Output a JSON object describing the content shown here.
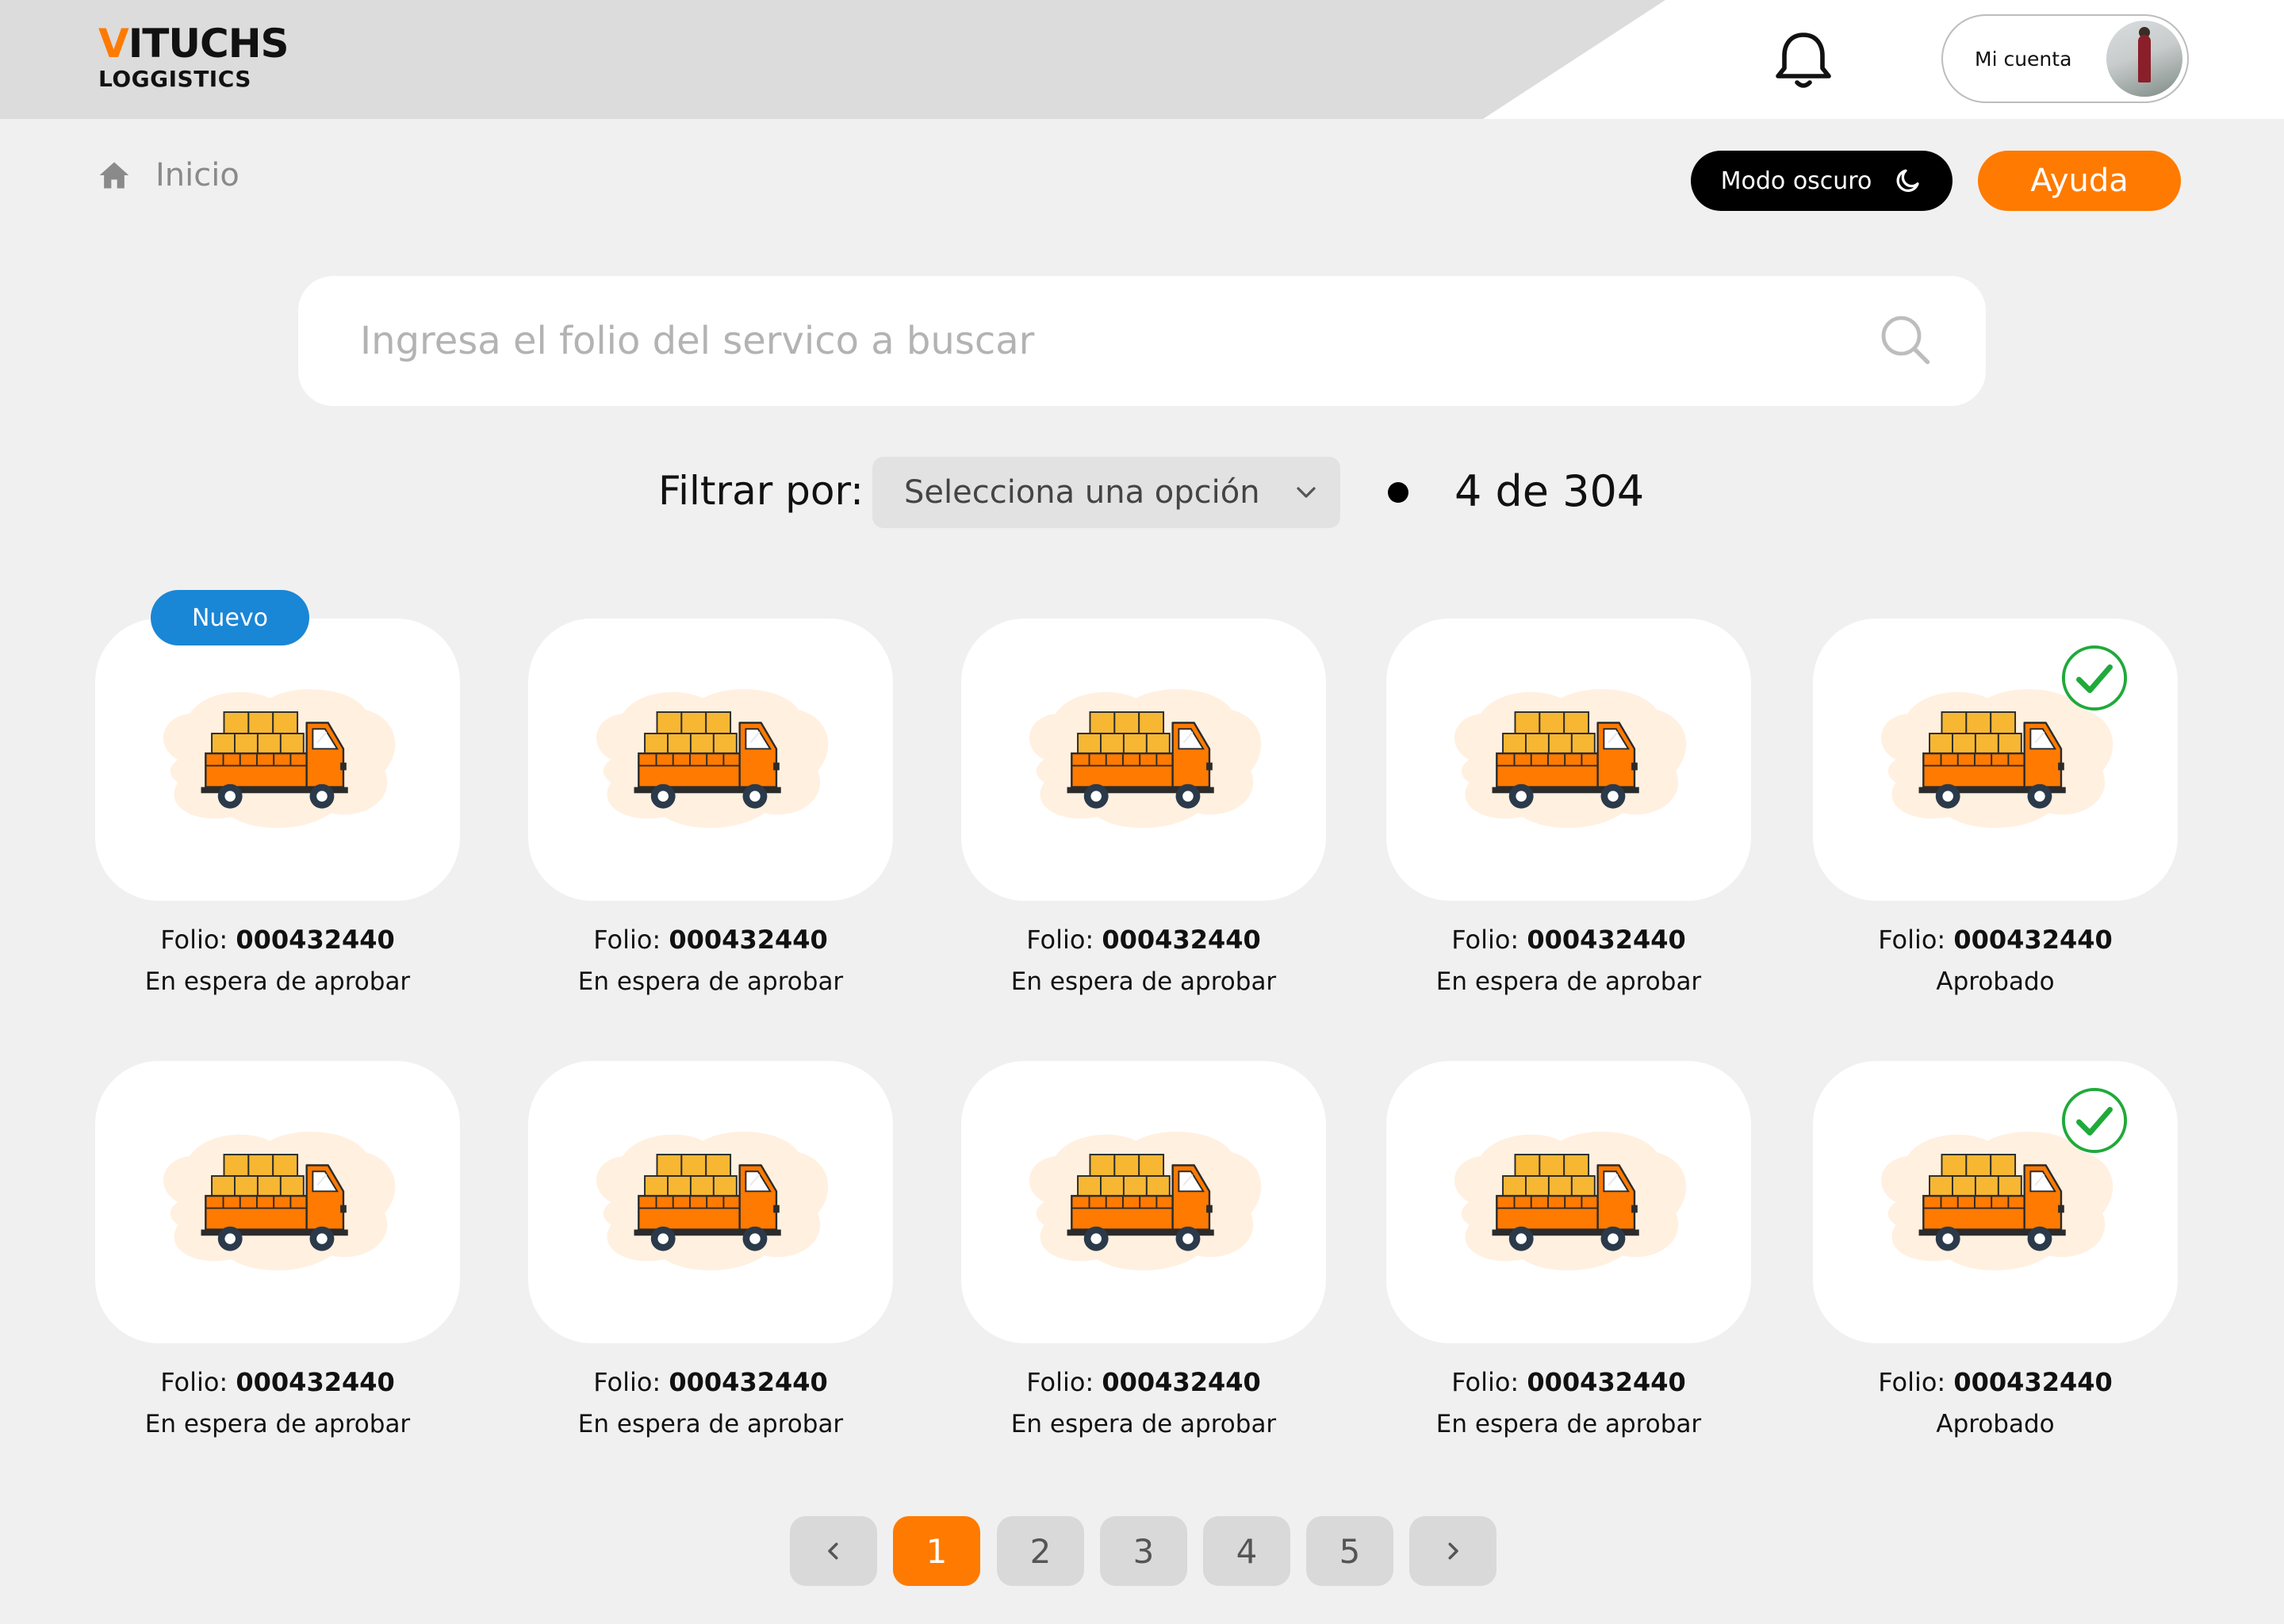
{
  "header": {
    "logo_top": "ITUCHS",
    "logo_v": "V",
    "logo_sub": "LOGGISTICS",
    "account_label": "Mi cuenta"
  },
  "breadcrumb": {
    "home": "Inicio"
  },
  "actions": {
    "dark_mode": "Modo oscuro",
    "help": "Ayuda"
  },
  "search": {
    "placeholder": "Ingresa el folio del servico a buscar"
  },
  "filter": {
    "label": "Filtrar por:",
    "selected": "Selecciona una opción",
    "count": "4 de 304"
  },
  "badge": {
    "new": "Nuevo"
  },
  "cards": [
    {
      "folio_label": "Folio:",
      "folio": "000432440",
      "status": "En espera de aprobar"
    },
    {
      "folio_label": "Folio:",
      "folio": "000432440",
      "status": "En espera de aprobar"
    },
    {
      "folio_label": "Folio:",
      "folio": "000432440",
      "status": "En espera de aprobar"
    },
    {
      "folio_label": "Folio:",
      "folio": "000432440",
      "status": "En espera de aprobar"
    },
    {
      "folio_label": "Folio:",
      "folio": "000432440",
      "status": "Aprobado"
    },
    {
      "folio_label": "Folio:",
      "folio": "000432440",
      "status": "En espera de aprobar"
    },
    {
      "folio_label": "Folio:",
      "folio": "000432440",
      "status": "En espera de aprobar"
    },
    {
      "folio_label": "Folio:",
      "folio": "000432440",
      "status": "En espera de aprobar"
    },
    {
      "folio_label": "Folio:",
      "folio": "000432440",
      "status": "En espera de aprobar"
    },
    {
      "folio_label": "Folio:",
      "folio": "000432440",
      "status": "Aprobado"
    }
  ],
  "pagination": {
    "pages": [
      "1",
      "2",
      "3",
      "4",
      "5"
    ],
    "current": "1"
  },
  "colors": {
    "accent": "#ff7a00",
    "new_badge": "#1a86d6",
    "approved": "#1faa3a",
    "truck": "#ff7a00",
    "boxes": "#f7b733"
  }
}
